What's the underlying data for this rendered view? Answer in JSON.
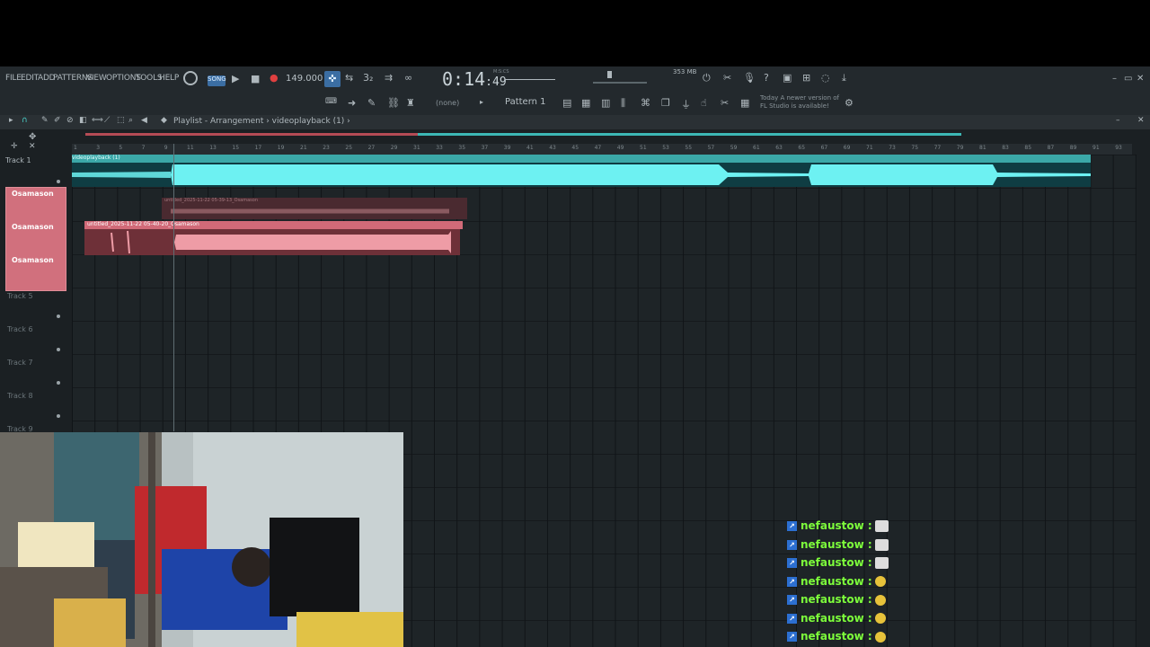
{
  "menu": [
    "FILE",
    "EDIT",
    "ADD",
    "PATTERNS",
    "VIEW",
    "OPTIONS",
    "TOOLS",
    "HELP"
  ],
  "transport": {
    "tempo": "149.000",
    "time": "0:14",
    "time_small": ":49",
    "time_unit": "M:S:CS"
  },
  "memory": "353 MB",
  "pattern": "Pattern 1",
  "none_label": "(none)",
  "news": {
    "line1": "Today  A newer version of",
    "line2": "FL Studio is available!"
  },
  "playlist": {
    "title": "Playlist - Arrangement › videoplayback (1) ›"
  },
  "ruler_ticks": [
    "1",
    "3",
    "5",
    "7",
    "9",
    "11",
    "13",
    "15",
    "17",
    "19",
    "21",
    "23",
    "25",
    "27",
    "29",
    "31",
    "33",
    "35",
    "37",
    "39",
    "41",
    "43",
    "45",
    "47",
    "49",
    "51",
    "53",
    "55",
    "57",
    "59",
    "61",
    "63",
    "65",
    "67",
    "69",
    "71",
    "73",
    "75",
    "77",
    "79",
    "81",
    "83",
    "85",
    "87",
    "89",
    "91",
    "93"
  ],
  "tracks": {
    "track1": "Track 1",
    "osamason1": "Osamason",
    "osamason2": "Osamason",
    "osamason3": "Osamason",
    "track5": "Track 5",
    "track6": "Track 6",
    "track7": "Track 7",
    "track8": "Track 8",
    "track9": "Track 9"
  },
  "clips": {
    "teal": "videoplayback (1)",
    "red1": "untitled_2025-11-22 05-39-13_Osamason",
    "red2": "untitled_2025-11-22 05-40-20_Osamason"
  },
  "chat": [
    {
      "user": "nefaustow",
      "emote": "gray"
    },
    {
      "user": "nefaustow",
      "emote": "gray"
    },
    {
      "user": "nefaustow",
      "emote": "gray"
    },
    {
      "user": "nefaustow",
      "emote": "yellow"
    },
    {
      "user": "nefaustow",
      "emote": "yellow"
    },
    {
      "user": "nefaustow",
      "emote": "yellow"
    },
    {
      "user": "nefaustow",
      "emote": "yellow"
    }
  ],
  "colors": {
    "accent": "#3db7b5",
    "clip_red": "#d16a78",
    "chat_user": "#7dff3b"
  }
}
